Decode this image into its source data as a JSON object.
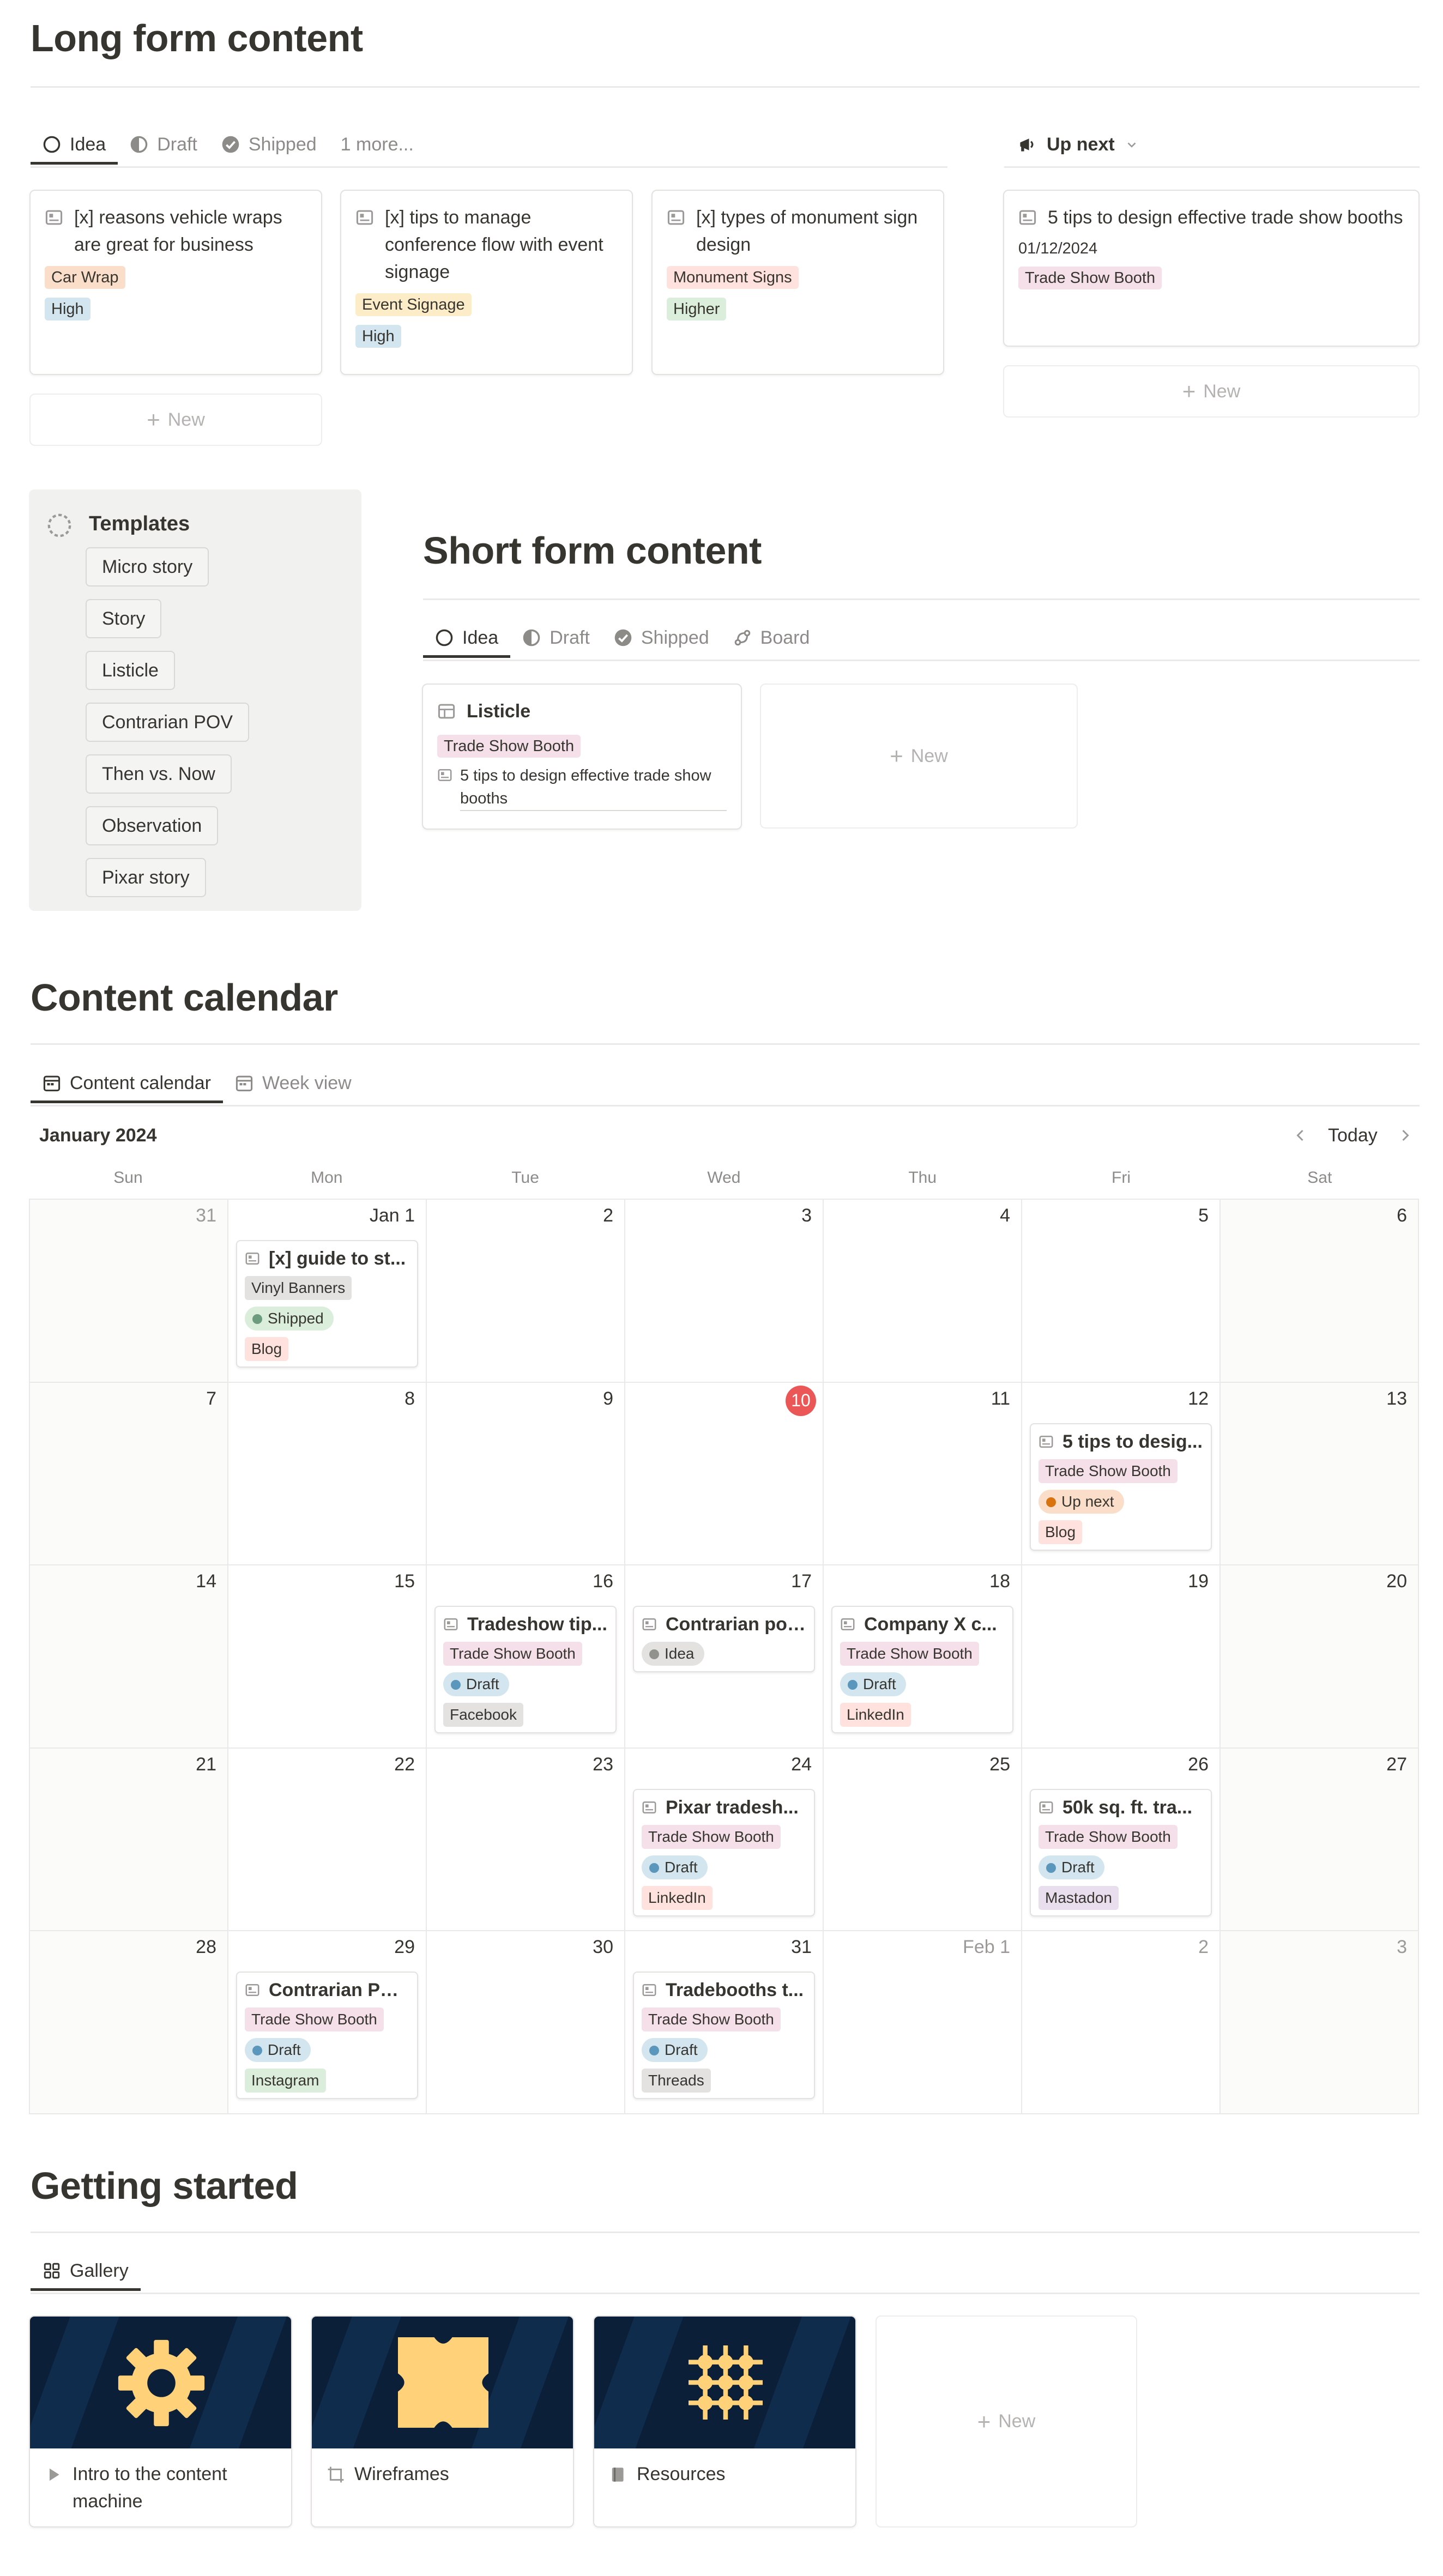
{
  "long_form": {
    "title": "Long form content",
    "tabs": [
      {
        "label": "Idea",
        "icon": "circle-outline-icon",
        "active": true
      },
      {
        "label": "Draft",
        "icon": "half-circle-icon",
        "active": false
      },
      {
        "label": "Shipped",
        "icon": "check-circle-icon",
        "active": false
      },
      {
        "label": "1 more...",
        "active": false
      }
    ],
    "cards": [
      {
        "title": "[x] reasons vehicle wraps are great for business",
        "tag": "Car Wrap",
        "priority": "High"
      },
      {
        "title": "[x] tips to manage conference flow with event signage",
        "tag": "Event Signage",
        "priority": "High"
      },
      {
        "title": "[x] types of monument sign design",
        "tag": "Monument Signs",
        "priority": "Higher"
      }
    ],
    "new_label": "New"
  },
  "up_next": {
    "label": "Up next",
    "card": {
      "title": "5 tips to design effective trade show booths",
      "date": "01/12/2024",
      "tag": "Trade Show Booth"
    },
    "new_label": "New"
  },
  "templates": {
    "title": "Templates",
    "items": [
      "Micro story",
      "Story",
      "Listicle",
      "Contrarian POV",
      "Then vs. Now",
      "Observation",
      "Pixar story"
    ]
  },
  "short_form": {
    "title": "Short form content",
    "tabs": [
      {
        "label": "Idea",
        "active": true
      },
      {
        "label": "Draft",
        "active": false
      },
      {
        "label": "Shipped",
        "active": false
      },
      {
        "label": "Board",
        "active": false
      }
    ],
    "card": {
      "title": "Listicle",
      "tag": "Trade Show Booth",
      "relation": "5 tips to design effective trade show booths"
    },
    "new_label": "New"
  },
  "calendar": {
    "title": "Content calendar",
    "tabs": [
      {
        "label": "Content calendar",
        "active": true
      },
      {
        "label": "Week view",
        "active": false
      }
    ],
    "month": "January 2024",
    "today_label": "Today",
    "weekdays": [
      "Sun",
      "Mon",
      "Tue",
      "Wed",
      "Thu",
      "Fri",
      "Sat"
    ],
    "days": [
      "31",
      "Jan 1",
      "2",
      "3",
      "4",
      "5",
      "6",
      "7",
      "8",
      "9",
      "10",
      "11",
      "12",
      "13",
      "14",
      "15",
      "16",
      "17",
      "18",
      "19",
      "20",
      "21",
      "22",
      "23",
      "24",
      "25",
      "26",
      "27",
      "28",
      "29",
      "30",
      "31",
      "Feb 1",
      "2",
      "3"
    ],
    "events": [
      {
        "cell": 1,
        "title": "[x] guide to st...",
        "tag": "Vinyl Banners",
        "status": "Shipped",
        "channel": "Blog"
      },
      {
        "cell": 12,
        "title": "5 tips to desig...",
        "tag": "Trade Show Booth",
        "status": "Up next",
        "channel": "Blog"
      },
      {
        "cell": 16,
        "title": "Tradeshow tip...",
        "tag": "Trade Show Booth",
        "status": "Draft",
        "channel": "Facebook"
      },
      {
        "cell": 17,
        "title": "Contrarian poi...",
        "status": "Idea"
      },
      {
        "cell": 18,
        "title": "Company X c...",
        "tag": "Trade Show Booth",
        "status": "Draft",
        "channel": "LinkedIn"
      },
      {
        "cell": 24,
        "title": "Pixar tradesh...",
        "tag": "Trade Show Booth",
        "status": "Draft",
        "channel": "LinkedIn"
      },
      {
        "cell": 26,
        "title": "50k sq. ft. tra...",
        "tag": "Trade Show Booth",
        "status": "Draft",
        "channel": "Mastadon"
      },
      {
        "cell": 29,
        "title": "Contrarian PO...",
        "tag": "Trade Show Booth",
        "status": "Draft",
        "channel": "Instagram"
      },
      {
        "cell": 31,
        "title": "Tradebooths t...",
        "tag": "Trade Show Booth",
        "status": "Draft",
        "channel": "Threads"
      }
    ]
  },
  "getting_started": {
    "title": "Getting started",
    "tab": "Gallery",
    "cards": [
      {
        "label": "Intro to the content machine",
        "icon": "play-triangle-icon",
        "cover": "gear-icon"
      },
      {
        "label": "Wireframes",
        "icon": "frame-icon",
        "cover": "quatrefoil-icon"
      },
      {
        "label": "Resources",
        "icon": "book-icon",
        "cover": "grid-dots-icon"
      }
    ],
    "new_label": "New"
  },
  "colors": {
    "car_wrap": "#fadec9",
    "event_signage": "#fdecc8",
    "monument": "#ffe2dd",
    "high": "#d3e5ef",
    "higher": "#dbeddb",
    "trade_show": "#f5e0e9",
    "gray_chip": "#e3e2e0",
    "blog": "#ffe2dd",
    "linkedin": "#ffe2dd",
    "instagram": "#dbeddb",
    "mastadon": "#e8deee",
    "today": "#eb5757",
    "cover": "#0b1f38",
    "cover_icon": "#ffd27a"
  }
}
